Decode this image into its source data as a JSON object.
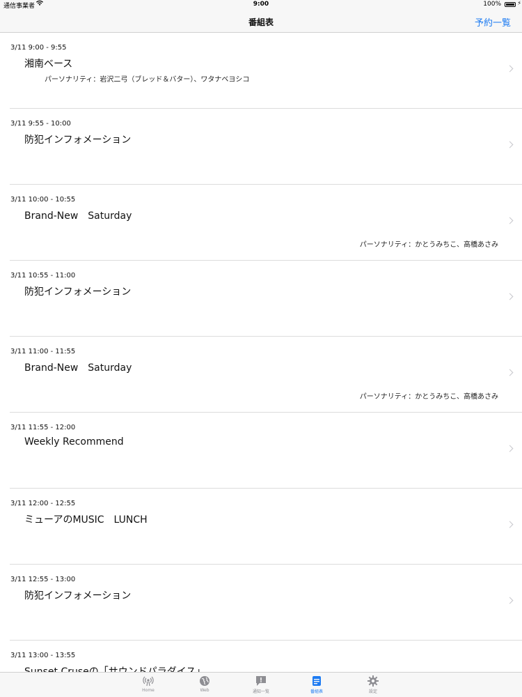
{
  "status": {
    "carrier": "通信事業者",
    "time": "9:00",
    "battery": "100%"
  },
  "nav": {
    "title": "番組表",
    "right_button": "予約一覧"
  },
  "programs": [
    {
      "time": "3/11 9:00 - 9:55",
      "title": "湘南ベース",
      "personality": "パーソナリティ：岩沢二弓（ブレッド＆バター）、ワタナベヨシコ",
      "personality_align": "left"
    },
    {
      "time": "3/11 9:55 - 10:00",
      "title": "防犯インフォメーション",
      "personality": "",
      "personality_align": "none"
    },
    {
      "time": "3/11 10:00 - 10:55",
      "title": "Brand-New　Saturday",
      "personality": "パーソナリティ：かとうみちこ、高橋あさみ",
      "personality_align": "right"
    },
    {
      "time": "3/11 10:55 - 11:00",
      "title": "防犯インフォメーション",
      "personality": "",
      "personality_align": "none"
    },
    {
      "time": "3/11 11:00 - 11:55",
      "title": "Brand-New　Saturday",
      "personality": "パーソナリティ：かとうみちこ、高橋あさみ",
      "personality_align": "right"
    },
    {
      "time": "3/11 11:55 - 12:00",
      "title": "Weekly Recommend",
      "personality": "",
      "personality_align": "none"
    },
    {
      "time": "3/11 12:00 - 12:55",
      "title": "ミューアのMUSIC　LUNCH",
      "personality": "",
      "personality_align": "none"
    },
    {
      "time": "3/11 12:55 - 13:00",
      "title": "防犯インフォメーション",
      "personality": "",
      "personality_align": "none"
    },
    {
      "time": "3/11 13:00 - 13:55",
      "title": "Sunset Cruseの「サウンドパラダイス」",
      "personality": "",
      "personality_align": "none"
    }
  ],
  "tabs": [
    {
      "label": "Home",
      "icon": "broadcast-icon",
      "active": false
    },
    {
      "label": "Web",
      "icon": "globe-icon",
      "active": false
    },
    {
      "label": "通知一覧",
      "icon": "notification-icon",
      "active": false
    },
    {
      "label": "番組表",
      "icon": "schedule-icon",
      "active": true
    },
    {
      "label": "設定",
      "icon": "gear-icon",
      "active": false
    }
  ],
  "colors": {
    "accent": "#1d7bf2",
    "inactive": "#8e8e93"
  }
}
